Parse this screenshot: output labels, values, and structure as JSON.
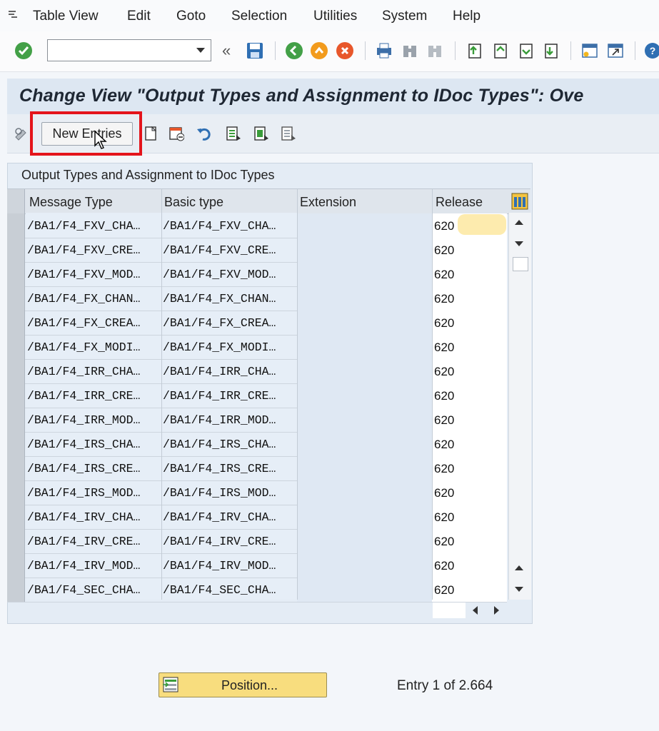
{
  "menu": {
    "items": [
      "Table View",
      "Edit",
      "Goto",
      "Selection",
      "Utilities",
      "System",
      "Help"
    ]
  },
  "toolbar": {
    "command_field_value": "",
    "icons": [
      "enter-icon",
      "back-history-icon",
      "save-icon",
      "back-icon",
      "exit-icon",
      "cancel-icon",
      "print-icon",
      "find-icon",
      "find-next-icon",
      "first-page-icon",
      "previous-page-icon",
      "next-page-icon",
      "last-page-icon",
      "create-session-icon",
      "shortcut-icon",
      "help-icon"
    ]
  },
  "title": "Change View \"Output Types and Assignment to IDoc Types\": Ove",
  "app_toolbar": {
    "new_entries_label": "New Entries"
  },
  "table": {
    "panel_title": "Output Types and Assignment to IDoc Types",
    "columns": [
      "Message Type",
      "Basic type",
      "Extension",
      "Release"
    ],
    "rows": [
      {
        "message_type": "/BA1/F4_FXV_CHA…",
        "basic_type": "/BA1/F4_FXV_CHA…",
        "extension": "",
        "release": "620"
      },
      {
        "message_type": "/BA1/F4_FXV_CRE…",
        "basic_type": "/BA1/F4_FXV_CRE…",
        "extension": "",
        "release": "620"
      },
      {
        "message_type": "/BA1/F4_FXV_MOD…",
        "basic_type": "/BA1/F4_FXV_MOD…",
        "extension": "",
        "release": "620"
      },
      {
        "message_type": "/BA1/F4_FX_CHAN…",
        "basic_type": "/BA1/F4_FX_CHAN…",
        "extension": "",
        "release": "620"
      },
      {
        "message_type": "/BA1/F4_FX_CREA…",
        "basic_type": "/BA1/F4_FX_CREA…",
        "extension": "",
        "release": "620"
      },
      {
        "message_type": "/BA1/F4_FX_MODI…",
        "basic_type": "/BA1/F4_FX_MODI…",
        "extension": "",
        "release": "620"
      },
      {
        "message_type": "/BA1/F4_IRR_CHA…",
        "basic_type": "/BA1/F4_IRR_CHA…",
        "extension": "",
        "release": "620"
      },
      {
        "message_type": "/BA1/F4_IRR_CRE…",
        "basic_type": "/BA1/F4_IRR_CRE…",
        "extension": "",
        "release": "620"
      },
      {
        "message_type": "/BA1/F4_IRR_MOD…",
        "basic_type": "/BA1/F4_IRR_MOD…",
        "extension": "",
        "release": "620"
      },
      {
        "message_type": "/BA1/F4_IRS_CHA…",
        "basic_type": "/BA1/F4_IRS_CHA…",
        "extension": "",
        "release": "620"
      },
      {
        "message_type": "/BA1/F4_IRS_CRE…",
        "basic_type": "/BA1/F4_IRS_CRE…",
        "extension": "",
        "release": "620"
      },
      {
        "message_type": "/BA1/F4_IRS_MOD…",
        "basic_type": "/BA1/F4_IRS_MOD…",
        "extension": "",
        "release": "620"
      },
      {
        "message_type": "/BA1/F4_IRV_CHA…",
        "basic_type": "/BA1/F4_IRV_CHA…",
        "extension": "",
        "release": "620"
      },
      {
        "message_type": "/BA1/F4_IRV_CRE…",
        "basic_type": "/BA1/F4_IRV_CRE…",
        "extension": "",
        "release": "620"
      },
      {
        "message_type": "/BA1/F4_IRV_MOD…",
        "basic_type": "/BA1/F4_IRV_MOD…",
        "extension": "",
        "release": "620"
      },
      {
        "message_type": "/BA1/F4_SEC_CHA…",
        "basic_type": "/BA1/F4_SEC_CHA…",
        "extension": "",
        "release": "620"
      }
    ]
  },
  "footer": {
    "position_label": "Position...",
    "entry_text": "Entry 1 of 2.664"
  },
  "colors": {
    "focus_frame": "#e4141b",
    "title_bg": "#dde7f2",
    "position_button": "#f8dd7e"
  }
}
